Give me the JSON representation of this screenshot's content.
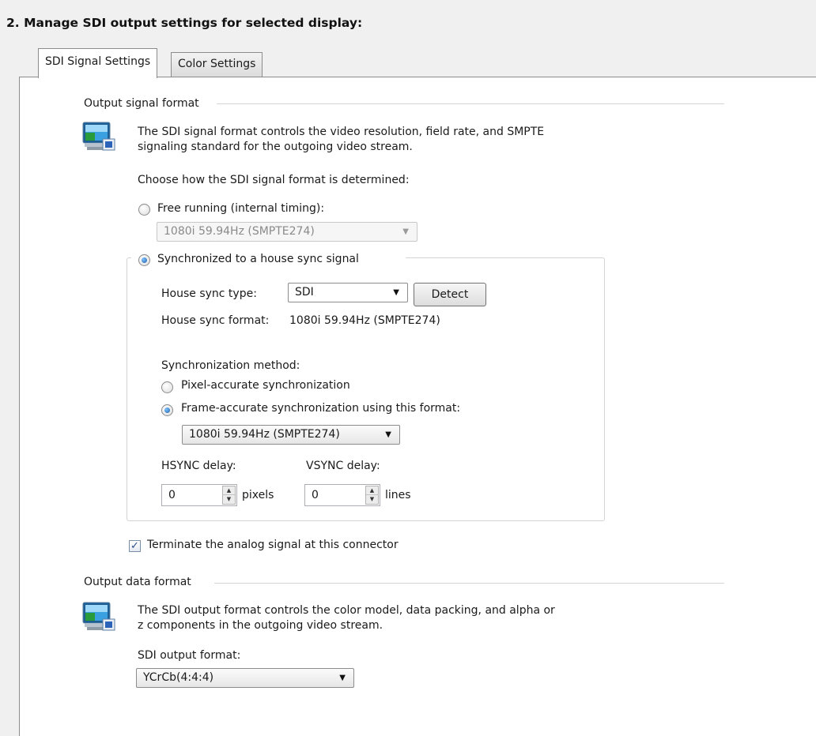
{
  "heading": "2. Manage SDI output settings for selected display:",
  "tabs": [
    {
      "label": "SDI Signal Settings",
      "active": true
    },
    {
      "label": "Color Settings",
      "active": false
    }
  ],
  "output_signal": {
    "group_label": "Output signal format",
    "icon": "monitor-icon",
    "description_line1": "The SDI signal format controls the video resolution, field rate, and SMPTE",
    "description_line2": "signaling standard for the outgoing video stream.",
    "choose_label": "Choose how the SDI signal format is determined:",
    "free_running_label": "Free running (internal timing):",
    "free_running_value": "1080i 59.94Hz (SMPTE274)",
    "synchronized_label": "Synchronized to a house sync signal",
    "house_sync_type_label": "House sync type:",
    "house_sync_type_value": "SDI",
    "detect_label": "Detect",
    "house_sync_format_label": "House sync format:",
    "house_sync_format_value": "1080i 59.94Hz (SMPTE274)",
    "sync_method_label": "Synchronization method:",
    "pixel_accurate_label": "Pixel-accurate synchronization",
    "frame_accurate_label": "Frame-accurate synchronization using this format:",
    "frame_format_value": "1080i 59.94Hz (SMPTE274)",
    "hsync_label": "HSYNC delay:",
    "hsync_value": "0",
    "hsync_unit": "pixels",
    "vsync_label": "VSYNC delay:",
    "vsync_value": "0",
    "vsync_unit": "lines",
    "terminate_label": "Terminate the analog signal at this connector",
    "terminate_checked": true
  },
  "output_data": {
    "group_label": "Output data format",
    "icon": "monitor-icon",
    "description_line1": "The SDI output format controls the color model, data packing, and alpha or",
    "description_line2": "z components in the outgoing video stream.",
    "format_label": "SDI output format:",
    "format_value": "YCrCb(4:4:4)"
  }
}
